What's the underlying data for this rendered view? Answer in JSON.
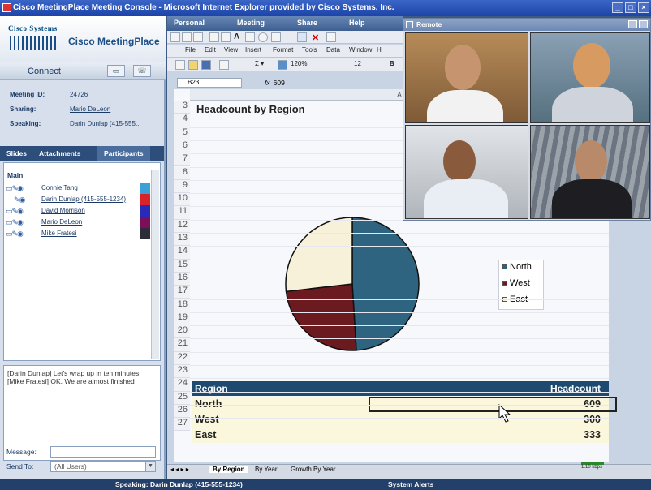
{
  "window": {
    "title": "Cisco MeetingPlace Meeting Console - Microsoft Internet Explorer provided by Cisco Systems, Inc."
  },
  "brand": {
    "company": "Cisco Systems",
    "product": "Cisco MeetingPlace"
  },
  "connect": {
    "label": "Connect"
  },
  "meeting": {
    "id_label": "Meeting ID:",
    "id_value": "24726",
    "sharing_label": "Sharing:",
    "sharing_value": "Mario DeLeon",
    "speaking_label": "Speaking:",
    "speaking_value": "Darin Dunlap (415-555..."
  },
  "tabs": {
    "slides": "Slides",
    "attachments": "Attachments",
    "participants": "Participants"
  },
  "participants": {
    "group": "Main",
    "items": [
      {
        "name": "Connie Tang",
        "color": "#3aa0d8"
      },
      {
        "name": "Darin Dunlap (415-555-1234)",
        "color": "#d8232a"
      },
      {
        "name": "David Morrison",
        "color": "#2a2ab8"
      },
      {
        "name": "Mario DeLeon",
        "color": "#7a0f5a"
      },
      {
        "name": "Mike Fratesi",
        "color": "#2d2d3a"
      }
    ]
  },
  "chat": {
    "lines": [
      "[Darin Dunlap] Let's wrap up in ten minutes",
      "[Mike Fratesi] OK. We are almost finished"
    ]
  },
  "message": {
    "message_label": "Message:",
    "sendto_label": "Send To:",
    "sendto_value": "(All Users)"
  },
  "app_menu": {
    "personal": "Personal",
    "meeting": "Meeting",
    "share": "Share",
    "help": "Help"
  },
  "excel": {
    "menu": [
      "File",
      "Edit",
      "View",
      "Insert",
      "Format",
      "Tools",
      "Data",
      "Window",
      "H"
    ],
    "zoom": "120%",
    "font_size": "12",
    "name_box": "B23",
    "formula_value": "609",
    "column": "A",
    "sheet_title": "Headcount by Region",
    "rows": [
      "3",
      "4",
      "5",
      "6",
      "7",
      "8",
      "9",
      "10",
      "11",
      "12",
      "13",
      "14",
      "15",
      "16",
      "17",
      "18",
      "19",
      "20",
      "21",
      "22",
      "23",
      "24",
      "25",
      "26",
      "27"
    ],
    "table_header": {
      "region": "Region",
      "headcount": "Headcount"
    },
    "table_rows": [
      {
        "region": "North",
        "value": "609"
      },
      {
        "region": "West",
        "value": "300"
      },
      {
        "region": "East",
        "value": "333"
      }
    ],
    "sheet_tabs": [
      "By Region",
      "By Year",
      "Growth By Year"
    ]
  },
  "chart_data": {
    "type": "pie",
    "categories": [
      "North",
      "West",
      "East"
    ],
    "values": [
      609,
      300,
      333
    ],
    "colors": [
      "#2e6480",
      "#6b1a1f",
      "#f6f1d8"
    ],
    "legend": "right"
  },
  "remote": {
    "title": "Remote"
  },
  "status": {
    "speaking": "Speaking:  Darin Dunlap (415-555-1234)",
    "alerts": "System Alerts",
    "kbps": "1.10 kbps"
  }
}
